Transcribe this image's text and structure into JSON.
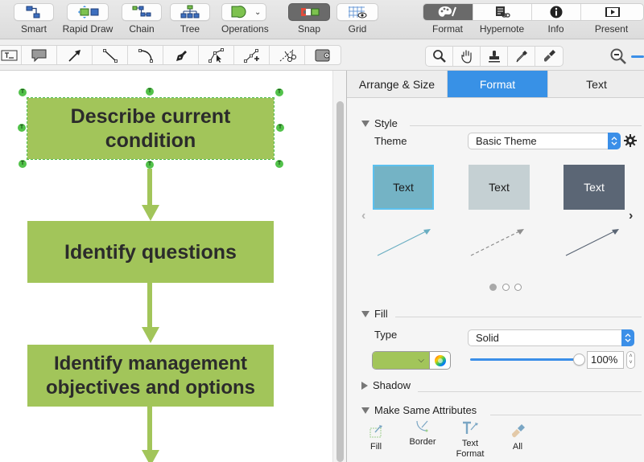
{
  "toolbar": {
    "items": [
      {
        "label": "Smart",
        "icon": "smart-connector-icon"
      },
      {
        "label": "Rapid Draw",
        "icon": "rapid-draw-icon"
      },
      {
        "label": "Chain",
        "icon": "chain-layout-icon"
      },
      {
        "label": "Tree",
        "icon": "tree-layout-icon"
      },
      {
        "label": "Operations",
        "icon": "shape-operations-icon"
      },
      {
        "label": "Snap",
        "icon": "snap-magnet-icon",
        "active": true
      },
      {
        "label": "Grid",
        "icon": "grid-icon"
      }
    ],
    "panel_toggle": [
      {
        "label": "Format",
        "icon": "palette-icon",
        "active": true
      },
      {
        "label": "Hypernote",
        "icon": "hypernote-icon"
      },
      {
        "label": "Info",
        "icon": "info-icon"
      },
      {
        "label": "Present",
        "icon": "present-icon"
      }
    ]
  },
  "drawing_tools": [
    "text-box-tool",
    "callout-tool",
    "arrow-tool",
    "line-tool",
    "arc-tool",
    "pen-tool",
    "direct-select-tool",
    "add-point-tool",
    "cut-path-tool",
    "container-tool"
  ],
  "view_tools": [
    "zoom-tool",
    "pan-hand-tool",
    "stamp-tool",
    "eyedropper-tool",
    "format-painter-tool"
  ],
  "canvas": {
    "nodes": [
      {
        "text": "Describe current condition",
        "selected": true
      },
      {
        "text": "Identify questions",
        "selected": false
      },
      {
        "text": "Identify management objectives and options",
        "selected": false
      }
    ],
    "node_fill": "#a2c55a",
    "handle_glyph": "T"
  },
  "panel": {
    "tabs": [
      {
        "label": "Arrange & Size",
        "active": false
      },
      {
        "label": "Format",
        "active": true
      },
      {
        "label": "Text",
        "active": false
      }
    ],
    "style": {
      "heading": "Style",
      "theme_label": "Theme",
      "theme_value": "Basic Theme",
      "cards": [
        {
          "label": "Text",
          "fill": "#74b3c5",
          "text_color": "#1a1a1a",
          "selected": true
        },
        {
          "label": "Text",
          "fill": "#c5d0d3",
          "text_color": "#1a1a1a",
          "selected": false
        },
        {
          "label": "Text",
          "fill": "#5b6675",
          "text_color": "#ffffff",
          "selected": false
        }
      ],
      "page_count": 3,
      "current_page": 1
    },
    "fill": {
      "heading": "Fill",
      "type_label": "Type",
      "type_value": "Solid",
      "color": "#a2c55a",
      "opacity_percent": 100,
      "opacity_text": "100%"
    },
    "shadow": {
      "heading": "Shadow"
    },
    "make_same": {
      "heading": "Make Same Attributes",
      "items": [
        {
          "label": "Fill",
          "icon": "make-same-fill-icon"
        },
        {
          "label": "Border",
          "icon": "make-same-border-icon"
        },
        {
          "label": "Text Format",
          "icon": "make-same-text-format-icon"
        },
        {
          "label": "All",
          "icon": "make-same-all-icon"
        }
      ]
    }
  }
}
